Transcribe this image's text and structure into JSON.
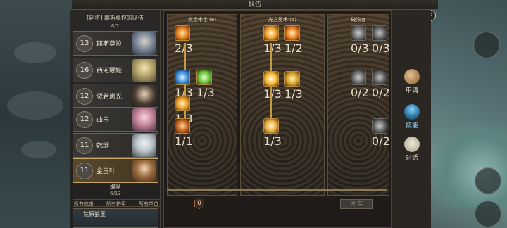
{
  "header": {
    "title": "队伍"
  },
  "team": {
    "title": "[副将] 耶斯莫拉的队伍",
    "count": "6/7",
    "members": [
      {
        "level": "13",
        "name": "耶斯莫拉",
        "selected": false
      },
      {
        "level": "16",
        "name": "西河娜娅",
        "selected": false
      },
      {
        "level": "12",
        "name": "贺若岚光",
        "selected": false
      },
      {
        "level": "12",
        "name": "曲玉",
        "selected": false
      },
      {
        "level": "11",
        "name": "韩珽",
        "selected": false
      },
      {
        "level": "11",
        "name": "金玉叶",
        "selected": true
      }
    ],
    "squad_label": "编队",
    "squad_count": "6/13",
    "filters": [
      "所有攻击",
      "所有护甲",
      "所有单位"
    ],
    "bottom_unit": "荒原狼王"
  },
  "tree": {
    "columns": [
      {
        "title": "焦金术士 (6)"
      },
      {
        "title": "光之巫术 (5)"
      },
      {
        "title": "破法者"
      }
    ],
    "skills": [
      {
        "pts": "2/3"
      },
      {
        "pts": "1/3"
      },
      {
        "pts": "1/3"
      },
      {
        "pts": "1/3"
      },
      {
        "pts": "1/1"
      },
      {
        "pts": "1/3"
      },
      {
        "pts": "1/2"
      },
      {
        "pts": "1/3"
      },
      {
        "pts": "1/3"
      },
      {
        "pts": "1/3"
      },
      {
        "pts": "0/3"
      },
      {
        "pts": "0/3"
      },
      {
        "pts": "0/2"
      },
      {
        "pts": "0/2"
      },
      {
        "pts": "0/2"
      }
    ],
    "available_points": "0",
    "save_label": "保 存"
  },
  "side": {
    "buttons": [
      {
        "label": "申请",
        "active": false
      },
      {
        "label": "技能",
        "active": true
      },
      {
        "label": "对话",
        "active": false
      }
    ]
  },
  "colors": {
    "accent_gold": "#c49a45",
    "selected_slot": "#c9a867",
    "active_tab": "#8fd0ff"
  }
}
